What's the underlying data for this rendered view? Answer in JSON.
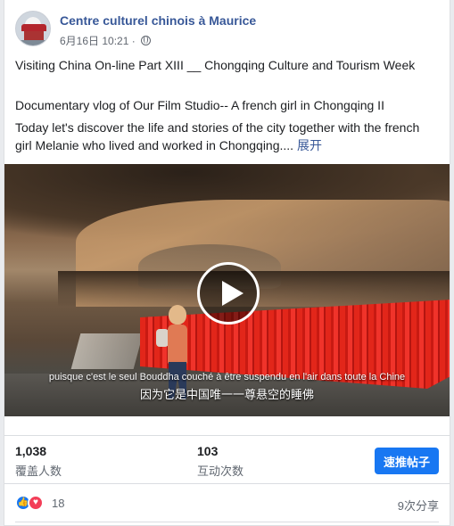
{
  "post": {
    "page_name": "Centre culturel chinois à Maurice",
    "date": "6月16日 10:21",
    "separator": " · ",
    "privacy_icon": "globe-icon",
    "line1": "Visiting China On-line Part XIII __ Chongqing Culture and Tourism Week",
    "line2": "Documentary vlog of Our Film Studio-- A french girl in Chongqing II",
    "line3": "Today let's discover the life and stories of the city together with the french girl Melanie who lived and worked in Chongqing....",
    "see_more": "展开"
  },
  "video": {
    "subtitle_fr": "puisque c'est le seul Bouddha couché à être suspendu en l'air dans toute la Chine",
    "subtitle_zh": "因为它是中国唯一一尊悬空的睡佛",
    "play_icon": "play-icon"
  },
  "stats": {
    "reach_value": "1,038",
    "reach_label": "覆盖人数",
    "engagement_value": "103",
    "engagement_label": "互动次数",
    "boost_label": "速推帖子"
  },
  "footer": {
    "reaction_icons": [
      "like-icon",
      "love-icon"
    ],
    "reaction_count": "18",
    "shares": "9次分享"
  },
  "colors": {
    "link": "#385898",
    "boost": "#1877f2",
    "like": "#1877f2",
    "love": "#f33e58"
  }
}
